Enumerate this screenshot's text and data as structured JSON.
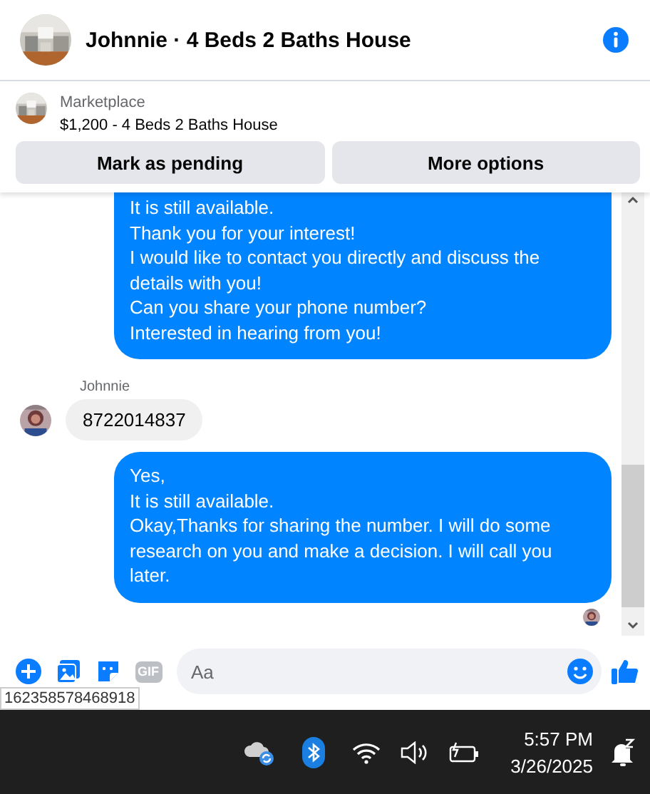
{
  "header": {
    "title": "Johnnie · 4 Beds 2 Baths House"
  },
  "listing": {
    "source": "Marketplace",
    "summary": "$1,200 - 4 Beds 2 Baths House",
    "buttons": [
      "Mark as pending",
      "More options"
    ]
  },
  "messages": [
    {
      "kind": "outgoing",
      "text": "It is still available.\nThank you for your interest!\nI would like to contact you directly and discuss the details with you!\nCan you share your phone number?\nInterested in hearing from you!"
    },
    {
      "kind": "incoming",
      "sender": "Johnnie",
      "text": "8722014837"
    },
    {
      "kind": "outgoing",
      "text": "Yes,\nIt is still available.\nOkay,Thanks for sharing the number. I will do some research on you and make a decision. I will call you later."
    }
  ],
  "composer": {
    "gif_label": "GIF",
    "placeholder": "Aa"
  },
  "tooltip": "162358578468918",
  "taskbar": {
    "time": "5:57 PM",
    "date": "3/26/2025"
  }
}
